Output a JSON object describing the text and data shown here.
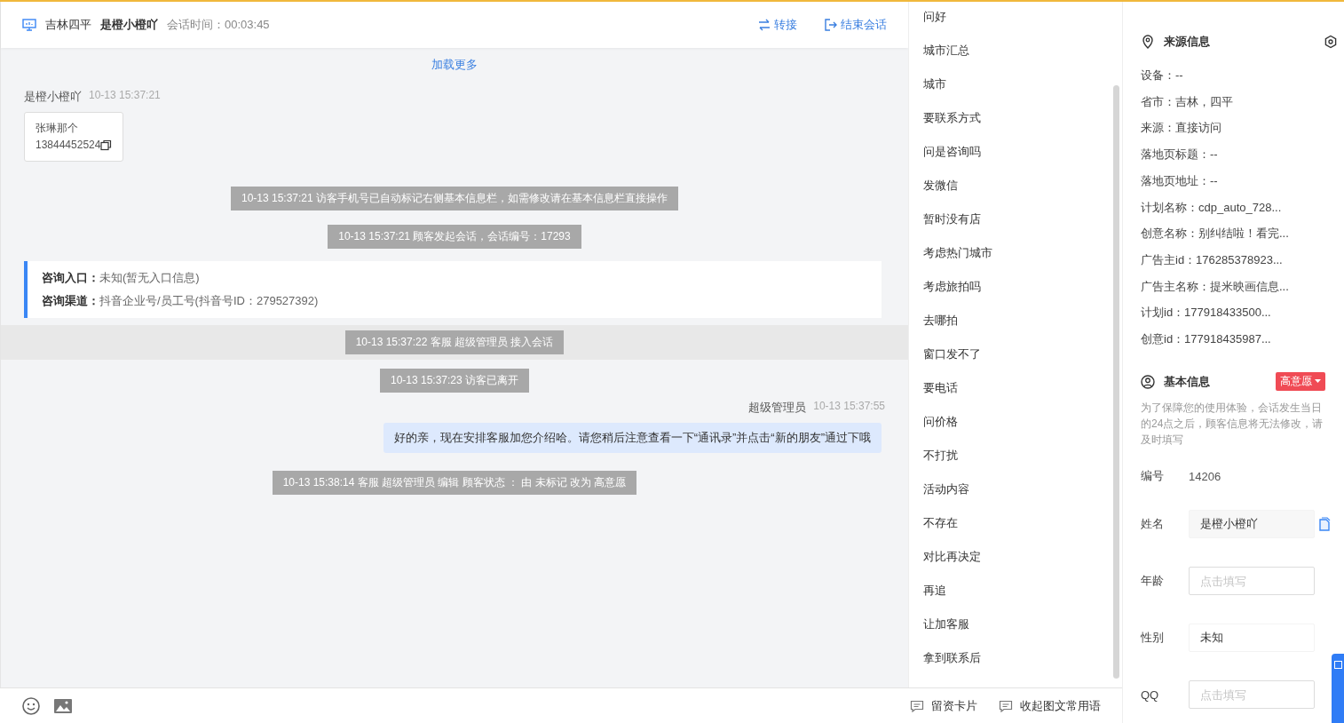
{
  "header": {
    "location": "吉林四平",
    "visitor": "是橙小橙吖",
    "duration": "会话时间：00:03:45",
    "actions": [
      {
        "kind": "transfer",
        "label": "转接"
      },
      {
        "kind": "end",
        "label": "结束会话"
      }
    ]
  },
  "messages": [
    {
      "kind": "load_more",
      "text": "加载更多"
    },
    {
      "kind": "visitor",
      "sender": "是橙小橙吖",
      "time": "10-13 15:37:21",
      "lines": [
        "张琳那个",
        "13844452524"
      ]
    },
    {
      "kind": "system",
      "text": "10-13 15:37:21 访客手机号已自动标记右侧基本信息栏，如需修改请在基本信息栏直接操作",
      "highlighted": false
    },
    {
      "kind": "system",
      "text": "10-13 15:37:21 顾客发起会话，会话编号：17293",
      "highlighted": false
    },
    {
      "kind": "entry",
      "rows": [
        {
          "label": "咨询入口：",
          "value": "未知(暂无入口信息)"
        },
        {
          "label": "咨询渠道：",
          "value": "抖音企业号/员工号(抖音号ID：279527392)"
        }
      ]
    },
    {
      "kind": "system",
      "text": "10-13 15:37:22 客服 超级管理员 接入会话",
      "highlighted": true
    },
    {
      "kind": "system",
      "text": "10-13 15:37:23 访客已离开",
      "highlighted": false
    },
    {
      "kind": "agent",
      "sender": "超级管理员",
      "time": "10-13 15:37:55",
      "text": "好的亲，现在安排客服加您介绍哈。请您稍后注意查看一下“通讯录”并点击“新的朋友”通过下哦"
    },
    {
      "kind": "system",
      "text": "10-13 15:38:14 客服 超级管理员 编辑 顾客状态 ： 由 未标记 改为 高意愿",
      "highlighted": false
    }
  ],
  "phrases": [
    "问好",
    "城市汇总",
    "城市",
    "要联系方式",
    "问是咨询吗",
    "发微信",
    "暂时没有店",
    "考虑热门城市",
    "考虑旅拍吗",
    "去哪拍",
    "窗口发不了",
    "要电话",
    "问价格",
    "不打扰",
    "活动内容",
    "不存在",
    "对比再决定",
    "再追",
    "让加客服",
    "拿到联系后"
  ],
  "toolbar": {
    "tools": [
      {
        "kind": "emoji"
      },
      {
        "kind": "image"
      }
    ],
    "actions": [
      "留资卡片",
      "收起图文常用语"
    ]
  },
  "source_info": {
    "title": "来源信息",
    "fields": [
      "设备：--",
      "省市：吉林，四平",
      "来源：直接访问",
      "落地页标题：--",
      "落地页地址：--",
      "计划名称：cdp_auto_728...",
      "创意名称：别纠结啦！看完...",
      "广告主id：176285378923...",
      "广告主名称：提米映画信息...",
      "计划id：177918433500...",
      "创意id：177918435987..."
    ]
  },
  "basic_info": {
    "title": "基本信息",
    "intent": "高意愿",
    "notice": "为了保障您的使用体验，会话发生当日的24点之后，顾客信息将无法修改，请及时填写",
    "fields": [
      {
        "kind": "text",
        "label": "编号",
        "value": "14206"
      },
      {
        "kind": "readonly",
        "label": "姓名",
        "value": "是橙小橙吖"
      },
      {
        "kind": "input",
        "label": "年龄",
        "placeholder": "点击填写"
      },
      {
        "kind": "select",
        "label": "性别",
        "value": "未知"
      },
      {
        "kind": "input",
        "label": "QQ",
        "placeholder": "点击填写"
      }
    ]
  }
}
